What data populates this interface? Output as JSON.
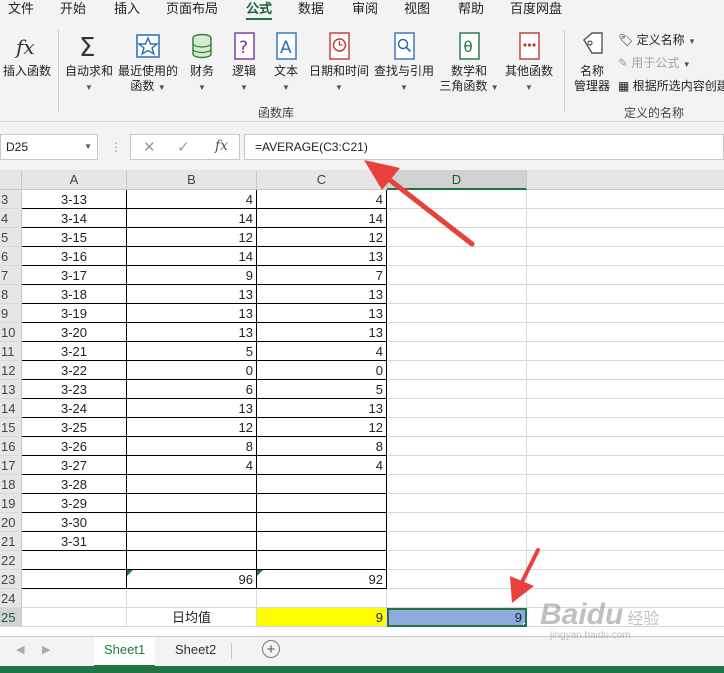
{
  "ribbon_tabs": [
    "文件",
    "开始",
    "插入",
    "页面布局",
    "公式",
    "数据",
    "审阅",
    "视图",
    "帮助",
    "百度网盘"
  ],
  "active_tab": "公式",
  "ribbon": {
    "insert_function": "插入函数",
    "autosum": "自动求和",
    "recent": [
      "最近使用的",
      "函数"
    ],
    "financial": "财务",
    "logical": "逻辑",
    "text": "文本",
    "datetime": "日期和时间",
    "lookup": "查找与引用",
    "math": [
      "数学和",
      "三角函数"
    ],
    "more": "其他函数",
    "function_library": "函数库",
    "name_manager": [
      "名称",
      "管理器"
    ],
    "define_name": "定义名称",
    "use_in_formula": "用于公式",
    "create_from_selection": "根据所选内容创建",
    "defined_names": "定义的名称"
  },
  "formula_bar": {
    "name_box": "D25",
    "cancel": "✕",
    "enter": "✓",
    "fx": "fx",
    "formula": "=AVERAGE(C3:C21)"
  },
  "columns": [
    "A",
    "B",
    "C",
    "D"
  ],
  "rows": [
    {
      "n": "3",
      "a": "3-13",
      "b": "4",
      "c": "4"
    },
    {
      "n": "4",
      "a": "3-14",
      "b": "14",
      "c": "14"
    },
    {
      "n": "5",
      "a": "3-15",
      "b": "12",
      "c": "12"
    },
    {
      "n": "6",
      "a": "3-16",
      "b": "14",
      "c": "13"
    },
    {
      "n": "7",
      "a": "3-17",
      "b": "9",
      "c": "7"
    },
    {
      "n": "8",
      "a": "3-18",
      "b": "13",
      "c": "13"
    },
    {
      "n": "9",
      "a": "3-19",
      "b": "13",
      "c": "13"
    },
    {
      "n": "10",
      "a": "3-20",
      "b": "13",
      "c": "13"
    },
    {
      "n": "11",
      "a": "3-21",
      "b": "5",
      "c": "4"
    },
    {
      "n": "12",
      "a": "3-22",
      "b": "0",
      "c": "0"
    },
    {
      "n": "13",
      "a": "3-23",
      "b": "6",
      "c": "5"
    },
    {
      "n": "14",
      "a": "3-24",
      "b": "13",
      "c": "13"
    },
    {
      "n": "15",
      "a": "3-25",
      "b": "12",
      "c": "12"
    },
    {
      "n": "16",
      "a": "3-26",
      "b": "8",
      "c": "8"
    },
    {
      "n": "17",
      "a": "3-27",
      "b": "4",
      "c": "4"
    },
    {
      "n": "18",
      "a": "3-28",
      "b": "",
      "c": ""
    },
    {
      "n": "19",
      "a": "3-29",
      "b": "",
      "c": ""
    },
    {
      "n": "20",
      "a": "3-30",
      "b": "",
      "c": ""
    },
    {
      "n": "21",
      "a": "3-31",
      "b": "",
      "c": ""
    },
    {
      "n": "22",
      "a": "",
      "b": "",
      "c": ""
    },
    {
      "n": "23",
      "a": "",
      "b": "96",
      "c": "92"
    },
    {
      "n": "24",
      "a": "",
      "b": "",
      "c": ""
    },
    {
      "n": "25",
      "a": "",
      "b": "日均值",
      "c": "9",
      "d": "9"
    }
  ],
  "colors": {
    "yellow": "#ffff00",
    "selected_fill": "#8faadc",
    "excel_green": "#217346",
    "arrow": "#e8413c"
  },
  "sheets": [
    "Sheet1",
    "Sheet2"
  ],
  "active_sheet": "Sheet1",
  "watermark": {
    "brand": "Baidu",
    "sub": "经验",
    "url": "jingyan.baidu.com"
  }
}
